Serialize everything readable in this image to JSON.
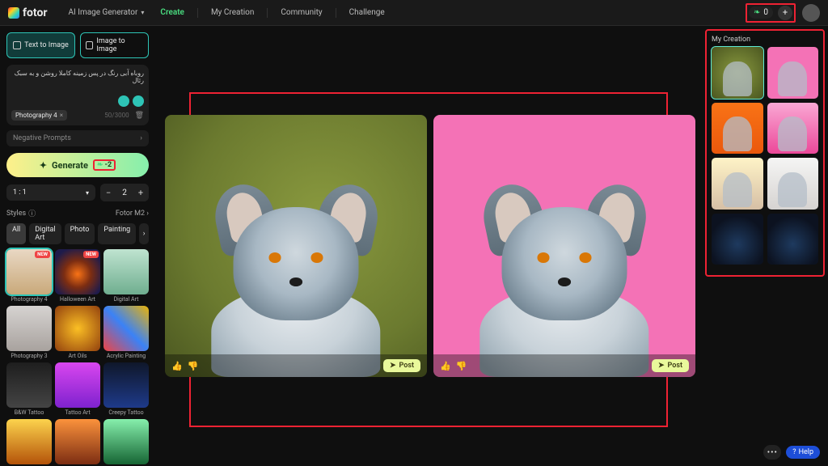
{
  "brand": "fotor",
  "nav": {
    "aiGen": "AI Image Generator",
    "create": "Create",
    "myCreation": "My Creation",
    "community": "Community",
    "challenge": "Challenge"
  },
  "credits": {
    "count": "0",
    "plus": "+"
  },
  "modes": {
    "txt2img": "Text to Image",
    "img2img": "Image to Image"
  },
  "prompt": {
    "text": "روباه آبی رنگ در پس زمینه کاملا روشن و به سبک رئال",
    "tag": "Photography 4",
    "counter": "50/3000",
    "negativeLabel": "Negative Prompts"
  },
  "generate": {
    "label": "Generate",
    "cost": "-2"
  },
  "aspect": {
    "value": "1 : 1",
    "qty": "2"
  },
  "styles": {
    "heading": "Styles",
    "model": "Fotor M2",
    "filters": [
      "All",
      "Digital Art",
      "Photo",
      "Painting"
    ],
    "items": [
      {
        "label": "Photography 4",
        "badge": "NEW",
        "cls": "s-photo4",
        "selected": true
      },
      {
        "label": "Halloween Art",
        "badge": "NEW",
        "cls": "s-halloween"
      },
      {
        "label": "Digital Art",
        "cls": "s-digital"
      },
      {
        "label": "Photography 3",
        "cls": "s-photo3"
      },
      {
        "label": "Art Oils",
        "cls": "s-artoils"
      },
      {
        "label": "Acrylic Painting",
        "cls": "s-acrylic"
      },
      {
        "label": "B&W Tattoo",
        "cls": "s-bwtat"
      },
      {
        "label": "Tattoo Art",
        "cls": "s-tatart"
      },
      {
        "label": "Creepy Tattoo",
        "cls": "s-creepy"
      },
      {
        "label": "",
        "cls": "s-row4a"
      },
      {
        "label": "",
        "cls": "s-row4b"
      },
      {
        "label": "",
        "cls": "s-row4c"
      }
    ]
  },
  "results": {
    "postLabel": "Post",
    "cards": [
      {
        "bgClass": "fox1"
      },
      {
        "bgClass": "fox2"
      }
    ]
  },
  "rightPanel": {
    "title": "My Creation",
    "thumbs": [
      {
        "cls": "rc-fox-olive",
        "selected": true
      },
      {
        "cls": "rc-fox-pink"
      },
      {
        "cls": "rc-cat-orange"
      },
      {
        "cls": "rc-cat-pink"
      },
      {
        "cls": "rc-cat-cream"
      },
      {
        "cls": "rc-cat-white"
      },
      {
        "cls": "rc-forest"
      },
      {
        "cls": "rc-forest"
      }
    ]
  },
  "help": {
    "label": "Help"
  }
}
